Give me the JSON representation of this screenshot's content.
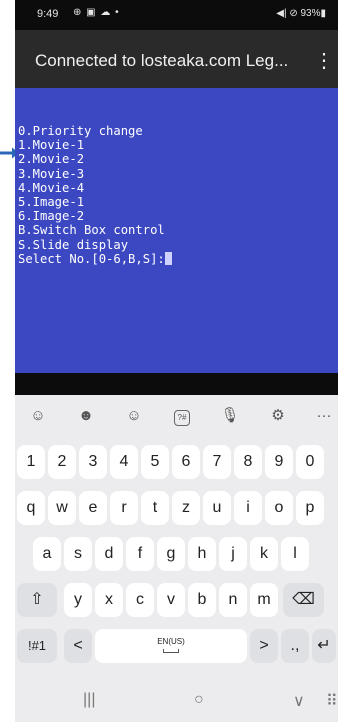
{
  "status_bar": {
    "time": "9:49",
    "left_icons": "⊕ ▣ ☁ •",
    "right_text": "◀| ⊘ 93%▮"
  },
  "app_bar": {
    "title": "Connected to losteaka.com Leg...",
    "more_label": "⋮"
  },
  "terminal": {
    "lines": [
      "0.Priority change",
      "1.Movie-1",
      "2.Movie-2",
      "3.Movie-3",
      "4.Movie-4",
      "5.Image-1",
      "6.Image-2",
      "B.Switch Box control",
      "S.Slide display"
    ],
    "prompt": "Select No.[0-6,B,S]:"
  },
  "keyboard": {
    "toolbar": [
      {
        "name": "emoji-icon",
        "glyph": "☺"
      },
      {
        "name": "sticker-icon",
        "glyph": "☻"
      },
      {
        "name": "bitmoji-icon",
        "glyph": "☺"
      },
      {
        "name": "clipboard-icon",
        "glyph": "?#"
      },
      {
        "name": "microphone-icon",
        "glyph": "🎙"
      },
      {
        "name": "settings-icon",
        "glyph": "⚙"
      },
      {
        "name": "more-icon",
        "glyph": "···"
      }
    ],
    "number_row": [
      "1",
      "2",
      "3",
      "4",
      "5",
      "6",
      "7",
      "8",
      "9",
      "0"
    ],
    "row1": [
      "q",
      "w",
      "e",
      "r",
      "t",
      "z",
      "u",
      "i",
      "o",
      "p"
    ],
    "row2": [
      "a",
      "s",
      "d",
      "f",
      "g",
      "h",
      "j",
      "k",
      "l"
    ],
    "row3": [
      "y",
      "x",
      "c",
      "v",
      "b",
      "n",
      "m"
    ],
    "shift_glyph": "⇧",
    "backspace_glyph": "⌫",
    "symbols_label": "!#1",
    "left_arrow": "<",
    "space_label": "EN(US)",
    "right_arrow": ">",
    "punct_label": ".,",
    "enter_glyph": "↵"
  },
  "nav_bar": {
    "recents": "|||",
    "home": "○",
    "back": "∨",
    "keyboard": "⠿"
  },
  "colors": {
    "terminal_bg": "#3c47c2",
    "arrow": "#2b67b8"
  }
}
